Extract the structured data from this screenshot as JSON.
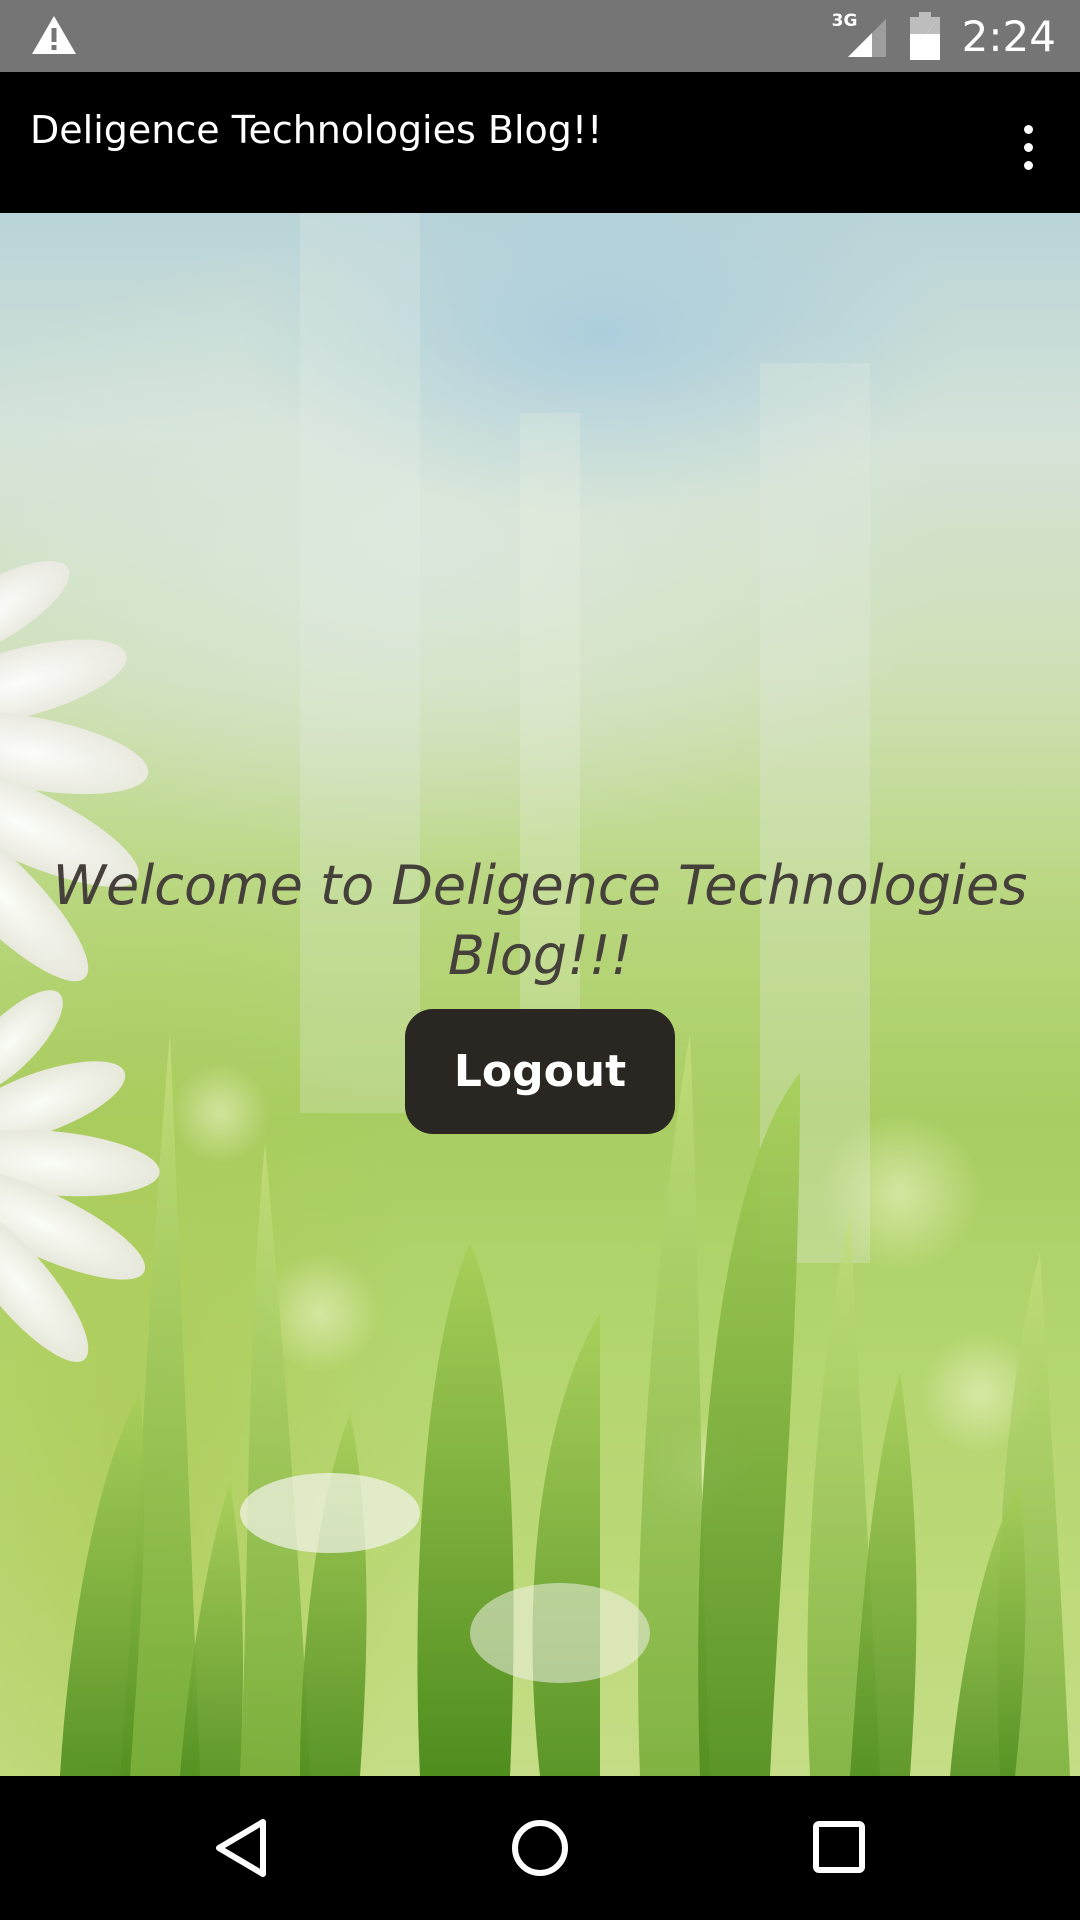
{
  "status_bar": {
    "network_type": "3G",
    "time": "2:24",
    "icons": [
      "warning-icon",
      "signal-icon",
      "battery-icon"
    ]
  },
  "toolbar": {
    "title": "Deligence Technologies Blog!!",
    "overflow_icon": "more-vert-icon"
  },
  "main": {
    "welcome_text": "Welcome to Deligence Technologies Blog!!!",
    "logout_label": "Logout"
  },
  "navigation": {
    "icons": [
      "back-icon",
      "home-icon",
      "recents-icon"
    ]
  },
  "colors": {
    "status_bar": "#757575",
    "toolbar": "#000000",
    "button": "#2a2622",
    "welcome_text": "#45403a"
  }
}
